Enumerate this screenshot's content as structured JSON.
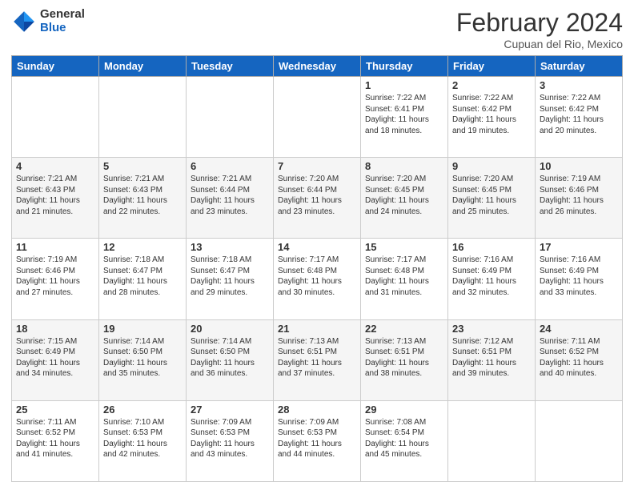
{
  "logo": {
    "general": "General",
    "blue": "Blue"
  },
  "header": {
    "month": "February 2024",
    "location": "Cupuan del Rio, Mexico"
  },
  "days": [
    "Sunday",
    "Monday",
    "Tuesday",
    "Wednesday",
    "Thursday",
    "Friday",
    "Saturday"
  ],
  "weeks": [
    [
      {
        "day": "",
        "info": ""
      },
      {
        "day": "",
        "info": ""
      },
      {
        "day": "",
        "info": ""
      },
      {
        "day": "",
        "info": ""
      },
      {
        "day": "1",
        "info": "Sunrise: 7:22 AM\nSunset: 6:41 PM\nDaylight: 11 hours and 18 minutes."
      },
      {
        "day": "2",
        "info": "Sunrise: 7:22 AM\nSunset: 6:42 PM\nDaylight: 11 hours and 19 minutes."
      },
      {
        "day": "3",
        "info": "Sunrise: 7:22 AM\nSunset: 6:42 PM\nDaylight: 11 hours and 20 minutes."
      }
    ],
    [
      {
        "day": "4",
        "info": "Sunrise: 7:21 AM\nSunset: 6:43 PM\nDaylight: 11 hours and 21 minutes."
      },
      {
        "day": "5",
        "info": "Sunrise: 7:21 AM\nSunset: 6:43 PM\nDaylight: 11 hours and 22 minutes."
      },
      {
        "day": "6",
        "info": "Sunrise: 7:21 AM\nSunset: 6:44 PM\nDaylight: 11 hours and 23 minutes."
      },
      {
        "day": "7",
        "info": "Sunrise: 7:20 AM\nSunset: 6:44 PM\nDaylight: 11 hours and 23 minutes."
      },
      {
        "day": "8",
        "info": "Sunrise: 7:20 AM\nSunset: 6:45 PM\nDaylight: 11 hours and 24 minutes."
      },
      {
        "day": "9",
        "info": "Sunrise: 7:20 AM\nSunset: 6:45 PM\nDaylight: 11 hours and 25 minutes."
      },
      {
        "day": "10",
        "info": "Sunrise: 7:19 AM\nSunset: 6:46 PM\nDaylight: 11 hours and 26 minutes."
      }
    ],
    [
      {
        "day": "11",
        "info": "Sunrise: 7:19 AM\nSunset: 6:46 PM\nDaylight: 11 hours and 27 minutes."
      },
      {
        "day": "12",
        "info": "Sunrise: 7:18 AM\nSunset: 6:47 PM\nDaylight: 11 hours and 28 minutes."
      },
      {
        "day": "13",
        "info": "Sunrise: 7:18 AM\nSunset: 6:47 PM\nDaylight: 11 hours and 29 minutes."
      },
      {
        "day": "14",
        "info": "Sunrise: 7:17 AM\nSunset: 6:48 PM\nDaylight: 11 hours and 30 minutes."
      },
      {
        "day": "15",
        "info": "Sunrise: 7:17 AM\nSunset: 6:48 PM\nDaylight: 11 hours and 31 minutes."
      },
      {
        "day": "16",
        "info": "Sunrise: 7:16 AM\nSunset: 6:49 PM\nDaylight: 11 hours and 32 minutes."
      },
      {
        "day": "17",
        "info": "Sunrise: 7:16 AM\nSunset: 6:49 PM\nDaylight: 11 hours and 33 minutes."
      }
    ],
    [
      {
        "day": "18",
        "info": "Sunrise: 7:15 AM\nSunset: 6:49 PM\nDaylight: 11 hours and 34 minutes."
      },
      {
        "day": "19",
        "info": "Sunrise: 7:14 AM\nSunset: 6:50 PM\nDaylight: 11 hours and 35 minutes."
      },
      {
        "day": "20",
        "info": "Sunrise: 7:14 AM\nSunset: 6:50 PM\nDaylight: 11 hours and 36 minutes."
      },
      {
        "day": "21",
        "info": "Sunrise: 7:13 AM\nSunset: 6:51 PM\nDaylight: 11 hours and 37 minutes."
      },
      {
        "day": "22",
        "info": "Sunrise: 7:13 AM\nSunset: 6:51 PM\nDaylight: 11 hours and 38 minutes."
      },
      {
        "day": "23",
        "info": "Sunrise: 7:12 AM\nSunset: 6:51 PM\nDaylight: 11 hours and 39 minutes."
      },
      {
        "day": "24",
        "info": "Sunrise: 7:11 AM\nSunset: 6:52 PM\nDaylight: 11 hours and 40 minutes."
      }
    ],
    [
      {
        "day": "25",
        "info": "Sunrise: 7:11 AM\nSunset: 6:52 PM\nDaylight: 11 hours and 41 minutes."
      },
      {
        "day": "26",
        "info": "Sunrise: 7:10 AM\nSunset: 6:53 PM\nDaylight: 11 hours and 42 minutes."
      },
      {
        "day": "27",
        "info": "Sunrise: 7:09 AM\nSunset: 6:53 PM\nDaylight: 11 hours and 43 minutes."
      },
      {
        "day": "28",
        "info": "Sunrise: 7:09 AM\nSunset: 6:53 PM\nDaylight: 11 hours and 44 minutes."
      },
      {
        "day": "29",
        "info": "Sunrise: 7:08 AM\nSunset: 6:54 PM\nDaylight: 11 hours and 45 minutes."
      },
      {
        "day": "",
        "info": ""
      },
      {
        "day": "",
        "info": ""
      }
    ]
  ]
}
